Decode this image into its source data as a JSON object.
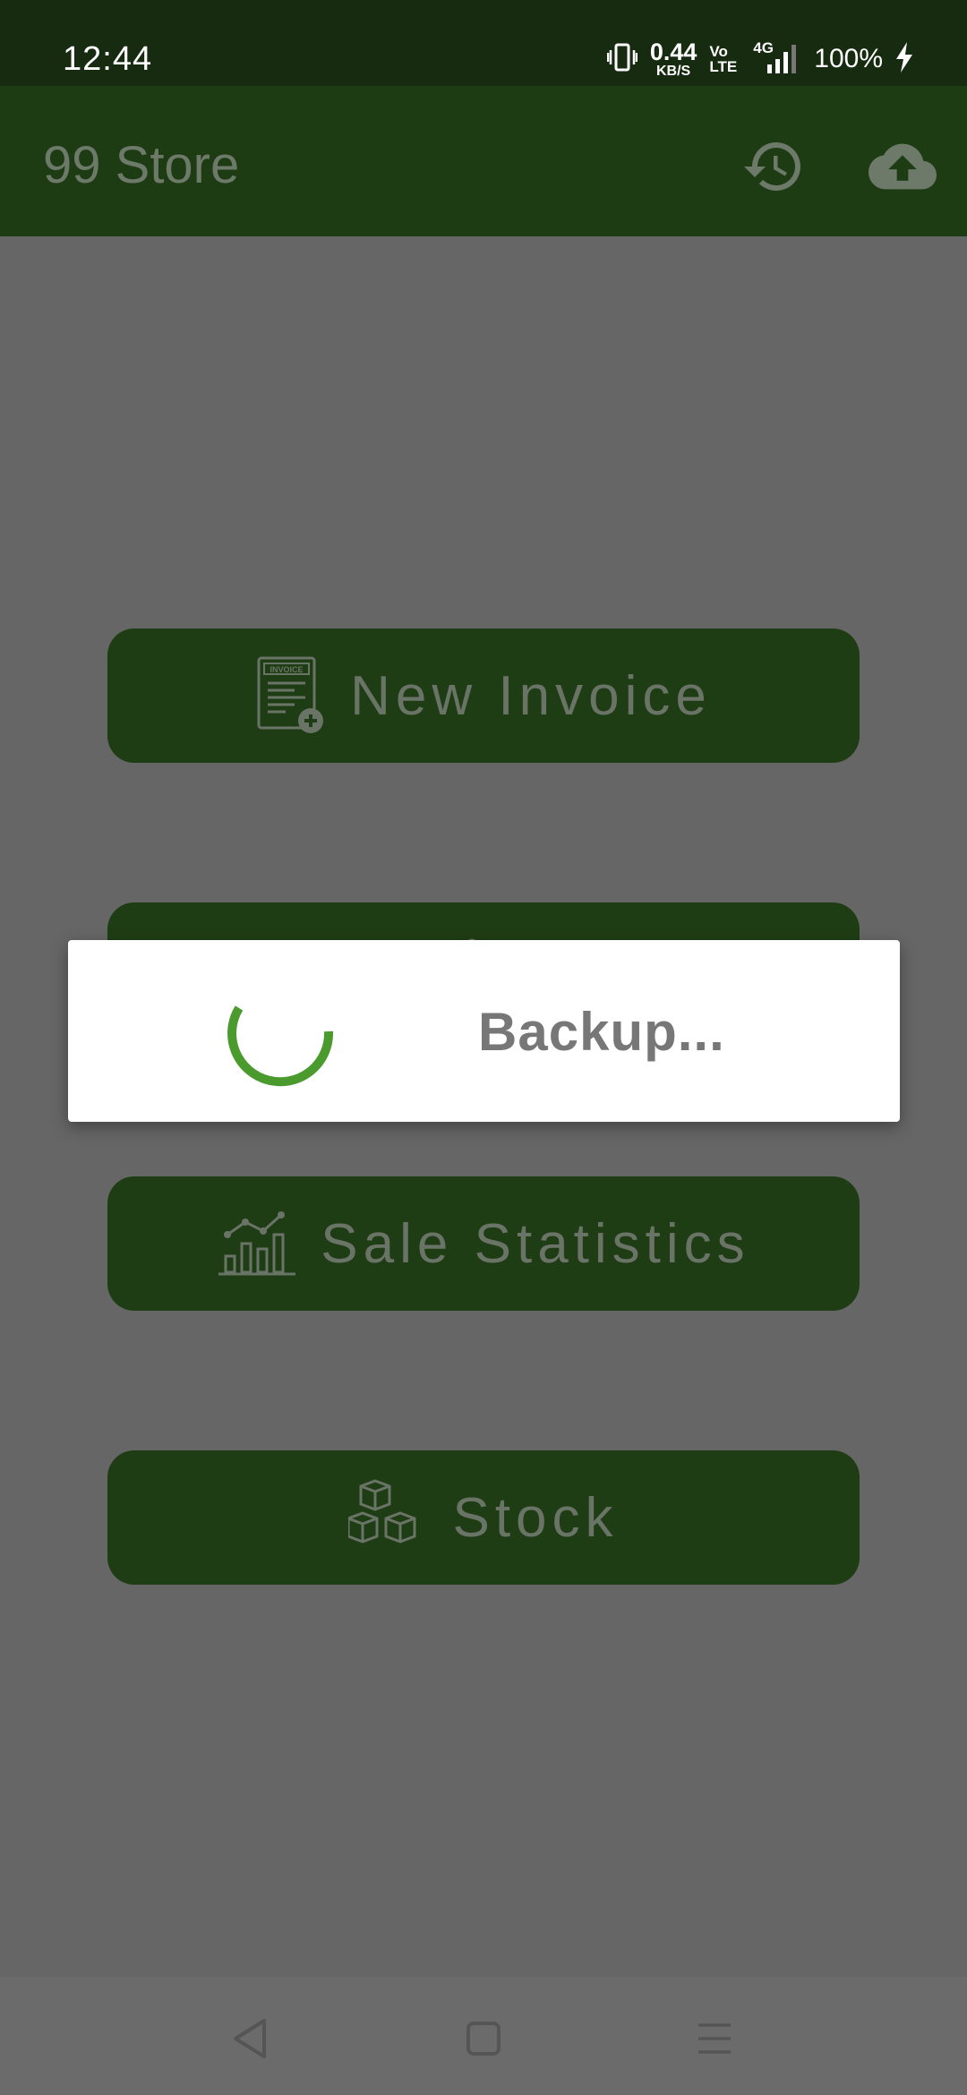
{
  "status_bar": {
    "time": "12:44",
    "net_speed_value": "0.44",
    "net_speed_unit": "KB/S",
    "volte_top": "Vo",
    "volte_bottom": "LTE",
    "network_type": "4G",
    "battery": "100%"
  },
  "app_bar": {
    "title": "99 Store",
    "icons": [
      "history-icon",
      "cloud-upload-icon"
    ]
  },
  "menu": {
    "items": [
      {
        "label": "New Invoice",
        "icon": "invoice-add-icon"
      },
      {
        "label": "",
        "icon": "box-icon"
      },
      {
        "label": "Sale Statistics",
        "icon": "statistics-chart-icon"
      },
      {
        "label": "Stock",
        "icon": "stock-boxes-icon"
      }
    ]
  },
  "dialog": {
    "message": "Backup...",
    "spinner_color": "#4a9a2e"
  },
  "nav_bar": {
    "icons": [
      "back-icon",
      "home-icon",
      "recents-icon"
    ]
  },
  "colors": {
    "status_bar": "#162b10",
    "app_bar": "#1e3c14",
    "button": "#1f3d14",
    "overlay": "#666666",
    "accent": "#4a9a2e"
  }
}
